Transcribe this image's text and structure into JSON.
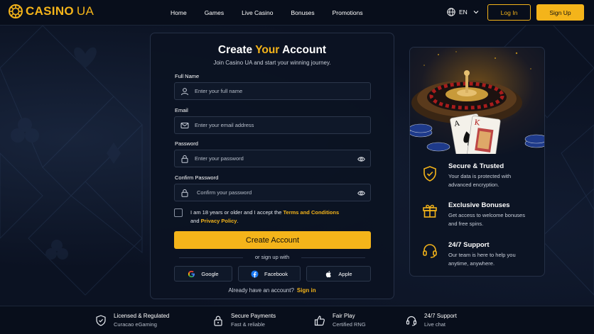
{
  "brand": {
    "name_primary": "CASINO",
    "name_secondary": "UA",
    "accent": "#f4b41a"
  },
  "nav": {
    "items": [
      "Home",
      "Games",
      "Live Casino",
      "Bonuses",
      "Promotions"
    ]
  },
  "header": {
    "language": "EN",
    "login_label": "Log In",
    "signup_label": "Sign Up"
  },
  "form": {
    "title_pre": "Create ",
    "title_highlight": "Your",
    "title_post": " Account",
    "subtitle": "Join Casino UA and start your winning journey.",
    "full_name": {
      "label": "Full Name",
      "placeholder": "Enter your full name"
    },
    "email": {
      "label": "Email",
      "placeholder": "Enter your email address"
    },
    "password": {
      "label": "Password",
      "placeholder": "Enter your password"
    },
    "confirm": {
      "label": "Confirm Password",
      "placeholder": "Confirm your password"
    },
    "terms_pre": "I am 18 years or older and I accept the ",
    "terms_link": "Terms and Conditions",
    "terms_mid": "and ",
    "privacy_link": "Privacy Policy",
    "terms_end": ".",
    "submit_label": "Create Account",
    "or_text": "or sign up with",
    "social": [
      "Google",
      "Facebook",
      "Apple"
    ],
    "already_text": "Already have an account?",
    "signin_label": "Sign in"
  },
  "features": [
    {
      "title": "Secure & Trusted",
      "desc": "Your data is protected with advanced encryption.",
      "icon": "shield-check-icon"
    },
    {
      "title": "Exclusive Bonuses",
      "desc": "Get access to welcome bonuses and free spins.",
      "icon": "gift-icon"
    },
    {
      "title": "24/7 Support",
      "desc": "Our team is here to help you anytime, anywhere.",
      "icon": "headset-icon"
    }
  ],
  "footer": [
    {
      "title": "Licensed & Regulated",
      "desc": "Curacao eGaming",
      "icon": "shield-icon"
    },
    {
      "title": "Secure Payments",
      "desc": "Fast & reliable",
      "icon": "lock-icon"
    },
    {
      "title": "Fair Play",
      "desc": "Certified RNG",
      "icon": "thumbs-up-icon"
    },
    {
      "title": "24/7 Support",
      "desc": "Live chat",
      "icon": "headset-icon"
    }
  ]
}
